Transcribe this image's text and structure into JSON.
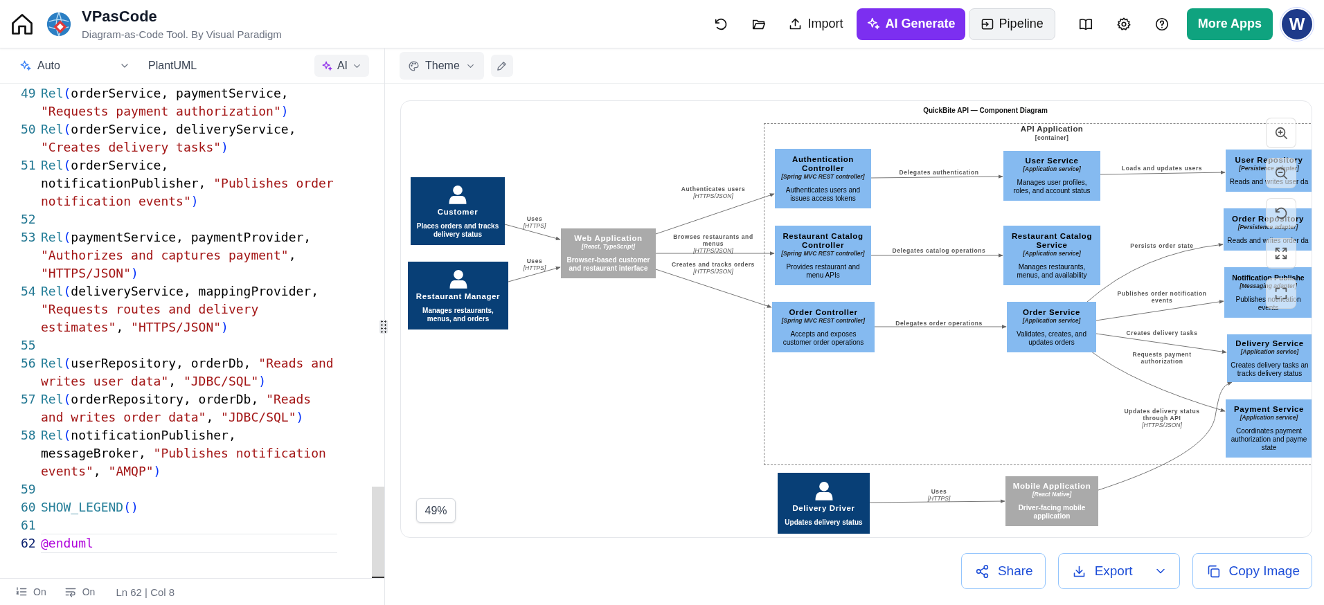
{
  "app": {
    "title": "VPasCode",
    "subtitle": "Diagram-as-Code Tool. By Visual Paradigm"
  },
  "toolbar": {
    "import": "Import",
    "ai_generate": "AI Generate",
    "pipeline": "Pipeline",
    "more_apps": "More Apps",
    "avatar": "W"
  },
  "editor": {
    "mode": "Auto",
    "language": "PlantUML",
    "ai": "AI",
    "lines": [
      {
        "number": "49",
        "current": false,
        "tokens": [
          {
            "kind": "fn",
            "text": "Rel"
          },
          {
            "kind": "punc",
            "text": "("
          },
          {
            "kind": "plain",
            "text": "orderService, paymentService, "
          },
          {
            "kind": "str",
            "text": "\"Requests payment authorization\""
          },
          {
            "kind": "punc",
            "text": ")"
          }
        ]
      },
      {
        "number": "50",
        "current": false,
        "tokens": [
          {
            "kind": "fn",
            "text": "Rel"
          },
          {
            "kind": "punc",
            "text": "("
          },
          {
            "kind": "plain",
            "text": "orderService, deliveryService, "
          },
          {
            "kind": "str",
            "text": "\"Creates delivery tasks\""
          },
          {
            "kind": "punc",
            "text": ")"
          }
        ]
      },
      {
        "number": "51",
        "current": false,
        "tokens": [
          {
            "kind": "fn",
            "text": "Rel"
          },
          {
            "kind": "punc",
            "text": "("
          },
          {
            "kind": "plain",
            "text": "orderService, notificationPublisher, "
          },
          {
            "kind": "str",
            "text": "\"Publishes order notification events\""
          },
          {
            "kind": "punc",
            "text": ")"
          }
        ]
      },
      {
        "number": "52",
        "current": false
      },
      {
        "number": "53",
        "current": false,
        "tokens": [
          {
            "kind": "fn",
            "text": "Rel"
          },
          {
            "kind": "punc",
            "text": "("
          },
          {
            "kind": "plain",
            "text": "paymentService, paymentProvider, "
          },
          {
            "kind": "str",
            "text": "\"Authorizes and captures payment\""
          },
          {
            "kind": "plain",
            "text": ", "
          },
          {
            "kind": "str",
            "text": "\"HTTPS/JSON\""
          },
          {
            "kind": "punc",
            "text": ")"
          }
        ]
      },
      {
        "number": "54",
        "current": false,
        "tokens": [
          {
            "kind": "fn",
            "text": "Rel"
          },
          {
            "kind": "punc",
            "text": "("
          },
          {
            "kind": "plain",
            "text": "deliveryService, mappingProvider, "
          },
          {
            "kind": "str",
            "text": "\"Requests routes and delivery estimates\""
          },
          {
            "kind": "plain",
            "text": ", "
          },
          {
            "kind": "str",
            "text": "\"HTTPS/JSON\""
          },
          {
            "kind": "punc",
            "text": ")"
          }
        ]
      },
      {
        "number": "55",
        "current": false
      },
      {
        "number": "56",
        "current": false,
        "tokens": [
          {
            "kind": "fn",
            "text": "Rel"
          },
          {
            "kind": "punc",
            "text": "("
          },
          {
            "kind": "plain",
            "text": "userRepository, orderDb, "
          },
          {
            "kind": "str",
            "text": "\"Reads and writes user data\""
          },
          {
            "kind": "plain",
            "text": ", "
          },
          {
            "kind": "str",
            "text": "\"JDBC/SQL\""
          },
          {
            "kind": "punc",
            "text": ")"
          }
        ]
      },
      {
        "number": "57",
        "current": false,
        "tokens": [
          {
            "kind": "fn",
            "text": "Rel"
          },
          {
            "kind": "punc",
            "text": "("
          },
          {
            "kind": "plain",
            "text": "orderRepository, orderDb, "
          },
          {
            "kind": "str",
            "text": "\"Reads and writes order data\""
          },
          {
            "kind": "plain",
            "text": ", "
          },
          {
            "kind": "str",
            "text": "\"JDBC/SQL\""
          },
          {
            "kind": "punc",
            "text": ")"
          }
        ]
      },
      {
        "number": "58",
        "current": false,
        "tokens": [
          {
            "kind": "fn",
            "text": "Rel"
          },
          {
            "kind": "punc",
            "text": "("
          },
          {
            "kind": "plain",
            "text": "notificationPublisher, messageBroker, "
          },
          {
            "kind": "str",
            "text": "\"Publishes notification events\""
          },
          {
            "kind": "plain",
            "text": ", "
          },
          {
            "kind": "str",
            "text": "\"AMQP\""
          },
          {
            "kind": "punc",
            "text": ")"
          }
        ]
      },
      {
        "number": "59",
        "current": false
      },
      {
        "number": "60",
        "current": false,
        "tokens": [
          {
            "kind": "fn",
            "text": "SHOW_LEGEND"
          },
          {
            "kind": "punc",
            "text": "()"
          }
        ]
      },
      {
        "number": "61",
        "current": false
      },
      {
        "number": "62",
        "current": true,
        "tokens": [
          {
            "kind": "kw",
            "text": "@enduml"
          }
        ]
      }
    ],
    "status": {
      "line_numbers": "On",
      "word_wrap": "On",
      "cursor": "Ln 62 | Col 8"
    }
  },
  "canvas": {
    "theme": "Theme",
    "zoom": "49%",
    "diagram": {
      "title": "QuickBite API — Component Diagram",
      "boundary": {
        "name": "API Application",
        "label": "[container]"
      },
      "nodes": [
        {
          "kind": "person",
          "name": "Customer",
          "description": [
            "Places orders and tracks",
            "delivery status"
          ]
        },
        {
          "kind": "person",
          "name": "Restaurant Manager",
          "description": [
            "Manages restaurants,",
            "menus, and orders"
          ]
        },
        {
          "kind": "container",
          "name": "Web Application",
          "technology": "[React, TypeScript]",
          "description": [
            "Browser-based customer",
            "and restaurant interface"
          ]
        },
        {
          "kind": "component",
          "name": "Authentication Controller",
          "technology": "[Spring MVC REST controller]",
          "description": [
            "Authenticates users and",
            "issues access tokens"
          ]
        },
        {
          "kind": "component",
          "name": "User Service",
          "technology": "[Application service]",
          "description": [
            "Manages user profiles,",
            "roles, and account status"
          ]
        },
        {
          "kind": "component",
          "name": "User Repository",
          "technology": "[Persistence adapter]",
          "description": [
            "Reads and writes user da"
          ]
        },
        {
          "kind": "component",
          "name": "Restaurant Catalog Controller",
          "technology": "[Spring MVC REST controller]",
          "description": [
            "Provides restaurant and",
            "menu APIs"
          ]
        },
        {
          "kind": "component",
          "name": "Restaurant Catalog Service",
          "technology": "[Application service]",
          "description": [
            "Manages restaurants,",
            "menus, and availability"
          ]
        },
        {
          "kind": "component",
          "name": "Order Repository",
          "technology": "[Persistence adapter]",
          "description": [
            "Reads and writes order da"
          ]
        },
        {
          "kind": "component",
          "name": "Notification Publishe",
          "technology": "[Messaging adapter]",
          "description": [
            "Publishes notification",
            "events"
          ]
        },
        {
          "kind": "component",
          "name": "Order Controller",
          "technology": "[Spring MVC REST controller]",
          "description": [
            "Accepts and exposes",
            "customer order operations"
          ]
        },
        {
          "kind": "component",
          "name": "Order Service",
          "technology": "[Application service]",
          "description": [
            "Validates, creates, and",
            "updates orders"
          ]
        },
        {
          "kind": "component",
          "name": "Delivery Service",
          "technology": "[Application service]",
          "description": [
            "Creates delivery tasks an",
            "tracks delivery status"
          ]
        },
        {
          "kind": "component",
          "name": "Payment Service",
          "technology": "[Application service]",
          "description": [
            "Coordinates payment",
            "authorization and payme",
            "state"
          ]
        },
        {
          "kind": "person",
          "name": "Delivery Driver",
          "description": [
            "Updates delivery status"
          ]
        },
        {
          "kind": "container",
          "name": "Mobile Application",
          "technology": "[React Native]",
          "description": [
            "Driver-facing mobile",
            "application"
          ]
        }
      ],
      "relations": [
        {
          "label": [
            "Uses"
          ],
          "technology": "[HTTPS]"
        },
        {
          "label": [
            "Uses"
          ],
          "technology": "[HTTPS]"
        },
        {
          "label": [
            "Authenticates users"
          ],
          "technology": "[HTTPS/JSON]"
        },
        {
          "label": [
            "Browses restaurants and",
            "menus"
          ],
          "technology": "[HTTPS/JSON]"
        },
        {
          "label": [
            "Creates and tracks orders"
          ],
          "technology": "[HTTPS/JSON]"
        },
        {
          "label": [
            "Delegates authentication"
          ]
        },
        {
          "label": [
            "Loads and updates users"
          ]
        },
        {
          "label": [
            "Delegates catalog operations"
          ]
        },
        {
          "label": [
            "Persists order state"
          ]
        },
        {
          "label": [
            "Publishes order notification",
            "events"
          ]
        },
        {
          "label": [
            "Delegates order operations"
          ]
        },
        {
          "label": [
            "Creates delivery tasks"
          ]
        },
        {
          "label": [
            "Requests payment",
            "authorization"
          ]
        },
        {
          "label": [
            "Updates delivery status",
            "through API"
          ],
          "technology": "[HTTPS/JSON]"
        },
        {
          "label": [
            "Uses"
          ],
          "technology": "[HTTPS]"
        }
      ]
    }
  },
  "actions": {
    "share": "Share",
    "export": "Export",
    "copy_image": "Copy Image"
  }
}
